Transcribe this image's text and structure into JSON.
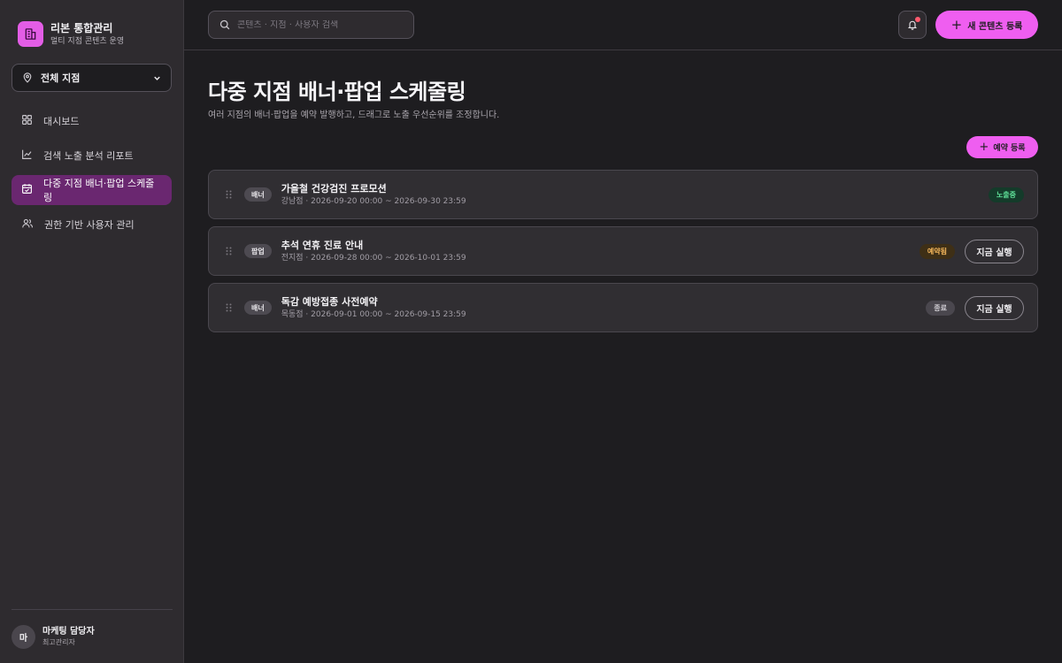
{
  "brand": {
    "title": "리본 통합관리",
    "subtitle": "멀티 지점 콘텐츠 운영"
  },
  "branch_select": {
    "value": "전체 지점"
  },
  "nav": {
    "items": [
      {
        "label": "대시보드",
        "icon": "grid-icon",
        "active": false
      },
      {
        "label": "검색 노출 분석 리포트",
        "icon": "trend-chart-icon",
        "active": false
      },
      {
        "label": "다중 지점 배너·팝업 스케줄링",
        "icon": "calendar-check-icon",
        "active": true
      },
      {
        "label": "권한 기반 사용자 관리",
        "icon": "users-icon",
        "active": false
      }
    ]
  },
  "user": {
    "initial": "마",
    "name": "마케팅 담당자",
    "role": "최고관리자"
  },
  "search": {
    "placeholder": "콘텐츠 · 지점 · 사용자 검색",
    "value": ""
  },
  "header": {
    "new_content_label": "새 콘텐츠 등록"
  },
  "page": {
    "title": "다중 지점 배너·팝업 스케줄링",
    "subtitle": "여러 지점의 배너·팝업을 예약 발행하고, 드래그로 노출 우선순위를 조정합니다.",
    "reserve_label": "예약 등록"
  },
  "schedules": [
    {
      "type": "배너",
      "title": "가을철 건강검진 프로모션",
      "meta": "강남점 · 2026-09-20 00:00 ~ 2026-09-30 23:59",
      "status": "노출중",
      "status_kind": "live",
      "action": ""
    },
    {
      "type": "팝업",
      "title": "추석 연휴 진료 안내",
      "meta": "전지점 · 2026-09-28 00:00 ~ 2026-10-01 23:59",
      "status": "예약됨",
      "status_kind": "reserved",
      "action": "지금 실행"
    },
    {
      "type": "배너",
      "title": "독감 예방접종 사전예약",
      "meta": "목동점 · 2026-09-01 00:00 ~ 2026-09-15 23:59",
      "status": "종료",
      "status_kind": "ended",
      "action": "지금 실행"
    }
  ],
  "colors": {
    "accent": "#ef5ef0",
    "active_nav": "#6a2770",
    "live": "#5ee098",
    "reserved": "#f6b85c",
    "notification_dot": "#ff5a6e"
  }
}
